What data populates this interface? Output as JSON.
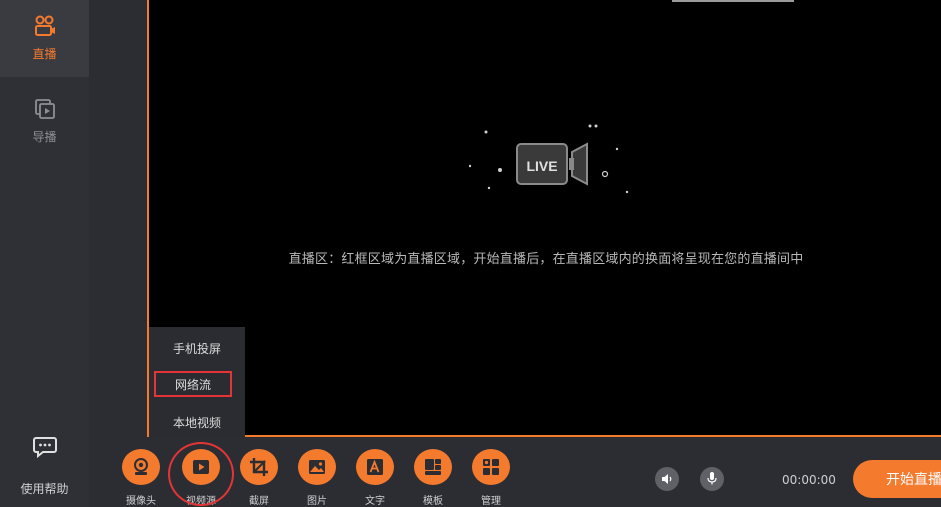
{
  "sidebar": {
    "live_label": "直播",
    "guide_label": "导播",
    "help_label": "使用帮助"
  },
  "preview": {
    "live_badge": "LIVE",
    "hint": "直播区：红框区域为直播区域，开始直播后，在直播区域内的换面将呈现在您的直播间中"
  },
  "video_source_menu": {
    "items": [
      "手机投屏",
      "网络流",
      "本地视频"
    ],
    "selected": "网络流"
  },
  "toolbar": {
    "tools": [
      "摄像头",
      "视频源",
      "截屏",
      "图片",
      "文字",
      "模板",
      "管理"
    ],
    "timer": "00:00:00",
    "start_label": "开始直播"
  },
  "colors": {
    "accent": "#f47a2e",
    "highlight": "#e33535",
    "preview_bg": "#000000"
  }
}
